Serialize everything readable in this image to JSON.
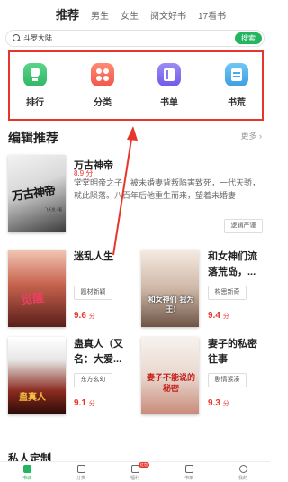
{
  "top_tabs": [
    "推荐",
    "男生",
    "女生",
    "阅文好书",
    "17看书"
  ],
  "search": {
    "text": "斗罗大陆",
    "button": "搜索"
  },
  "categories": [
    "排行",
    "分类",
    "书单",
    "书荒"
  ],
  "section": {
    "title": "编辑推荐",
    "more": "更多 ›"
  },
  "featured": {
    "title": "万古神帝",
    "score": "8.9 分",
    "description": "堂堂明帝之子，被未婚妻背叛陷害致死，一代天骄，就此陨落。八百年后他重生而来，望着未婚妻",
    "cover_title": "万古神帝",
    "cover_author": "飞天鱼 / 著",
    "tag": "逻辑严谨"
  },
  "books": [
    {
      "title": "迷乱人生",
      "tag": "题材新颖",
      "score": "9.6",
      "unit": "分",
      "cover_text": "觉醒"
    },
    {
      "title": "和女神们流落荒岛，...",
      "tag": "构思新奇",
      "score": "9.4",
      "unit": "分",
      "cover_text": "和女神们 我为王!"
    },
    {
      "title": "蛊真人（又名：大爱...",
      "tag": "东方玄幻",
      "score": "9.1",
      "unit": "分",
      "cover_text": "蛊真人"
    },
    {
      "title": "妻子的私密往事",
      "tag": "剧情紧凑",
      "score": "9.3",
      "unit": "分",
      "cover_text": "妻子不能说的秘密"
    }
  ],
  "private_section": "私人定制",
  "bottom_nav": {
    "items": [
      "书城",
      "分类",
      "福利",
      "书架",
      "我的"
    ],
    "badge": "红包"
  }
}
